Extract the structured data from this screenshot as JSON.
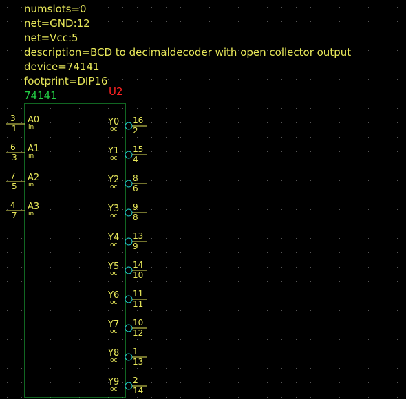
{
  "attributes": [
    "numslots=0",
    "net=GND:12",
    "net=Vcc:5",
    "description=BCD to decimaldecoder with open collector output",
    "device=74141",
    "footprint=DIP16"
  ],
  "symbol": {
    "device_label": "74141",
    "refdes": "U2",
    "body_color": "#22cc44",
    "pin_line_color": "#e8e85a",
    "bubble_color": "#22cccc",
    "text_color": "#e8e85a",
    "refdes_color": "#ff2222"
  },
  "left_pins": [
    {
      "name": "A0",
      "type": "in",
      "pin_number": "3",
      "pin_seq": "1"
    },
    {
      "name": "A1",
      "type": "in",
      "pin_number": "6",
      "pin_seq": "3"
    },
    {
      "name": "A2",
      "type": "in",
      "pin_number": "7",
      "pin_seq": "5"
    },
    {
      "name": "A3",
      "type": "in",
      "pin_number": "4",
      "pin_seq": "7"
    }
  ],
  "right_pins": [
    {
      "name": "Y0",
      "type": "oc",
      "pin_number": "16",
      "pin_seq": "2"
    },
    {
      "name": "Y1",
      "type": "oc",
      "pin_number": "15",
      "pin_seq": "4"
    },
    {
      "name": "Y2",
      "type": "oc",
      "pin_number": "8",
      "pin_seq": "6"
    },
    {
      "name": "Y3",
      "type": "oc",
      "pin_number": "9",
      "pin_seq": "8"
    },
    {
      "name": "Y4",
      "type": "oc",
      "pin_number": "13",
      "pin_seq": "9"
    },
    {
      "name": "Y5",
      "type": "oc",
      "pin_number": "14",
      "pin_seq": "10"
    },
    {
      "name": "Y6",
      "type": "oc",
      "pin_number": "11",
      "pin_seq": "11"
    },
    {
      "name": "Y7",
      "type": "oc",
      "pin_number": "10",
      "pin_seq": "12"
    },
    {
      "name": "Y8",
      "type": "oc",
      "pin_number": "1",
      "pin_seq": "13"
    },
    {
      "name": "Y9",
      "type": "oc",
      "pin_number": "2",
      "pin_seq": "14"
    }
  ]
}
